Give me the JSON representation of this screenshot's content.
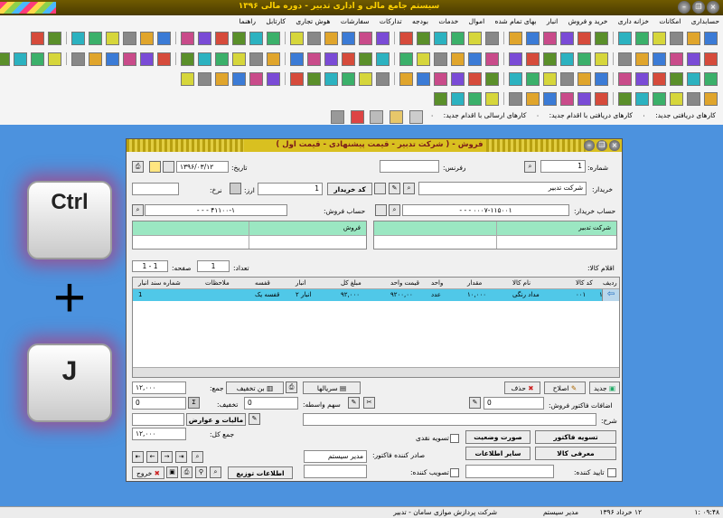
{
  "app": {
    "title": "سیستم جامع مالی و اداری تدبیر - دوره مالی ۱۳۹۶"
  },
  "menu": [
    "حسابداری",
    "امکانات",
    "خزانه داری",
    "خرید و فروش",
    "انبار",
    "بهای تمام شده",
    "اموال",
    "خدمات",
    "بودجه",
    "تدارکات",
    "سفارشات",
    "هوش تجاری",
    "کارتابل",
    "راهنما"
  ],
  "cartable": {
    "inbox": "کارهای دریافتی جدید:",
    "inbox_action": "کارهای دریافتی با اقدام جدید:",
    "sent_action": "کارهای ارسالی با اقدام جدید:"
  },
  "shortcut": {
    "key1": "Ctrl",
    "plus": "+",
    "key2": "J"
  },
  "status": {
    "time": "۰۹:۴۸ :۱",
    "date": "۱۲ خرداد ۱۳۹۶",
    "user": "مدیر سیستم",
    "company": "شرکت پردازش موازی سامان - تدبیر"
  },
  "window": {
    "title": "فروش - ( شرکت تدبیر - قیمت پیشنهادی - قیمت اول )",
    "number_label": "شماره:",
    "number_value": "1",
    "ref_label": "رفرنس:",
    "ref_value": "",
    "date_label": "تاریخ:",
    "date_value": "۱۳۹۶/۰۳/۱۲",
    "buyer_label": "خریدار:",
    "buyer_value": "شرکت تدبیر",
    "buyer_code_button": "کد خریدار",
    "currency_label": "ارز:",
    "currency_value": "1",
    "rate_label": "نرخ:",
    "rate_value": "",
    "buyer_account_label": "حساب خریدار:",
    "buyer_account_value": "- - - ۰۰۰۷-۱۱۵۰۰۱",
    "buyer_account_name": "شرکت تدبیر",
    "sales_account_label": "حساب فروش:",
    "sales_account_value": "- - - ۴۱۱۰۰-۱",
    "sales_account_name": "فروش",
    "items_label": "اقلام کالا:",
    "count_label": "تعداد:",
    "count_value": "1",
    "page_label": "صفحه:",
    "page_value": "1 - 1",
    "table": {
      "headers": [
        "ردیف",
        "کد کالا",
        "نام کالا",
        "مقدار",
        "واحد",
        "قیمت واحد",
        "مبلغ کل",
        "انبار",
        "قفسه",
        "ملاحظات",
        "شماره سند انبار"
      ],
      "rows": [
        [
          "۱",
          "۰۰۱",
          "مداد رنگی",
          "۱۰,۰۰۰",
          "عدد",
          "۹۲۰۰,۰۰",
          "۹۲,۰۰۰",
          "انبار ۲",
          "قفسه یک",
          "",
          "1"
        ]
      ]
    },
    "new_btn": "جدید",
    "edit_btn": "اصلاح",
    "delete_btn": "حذف",
    "series_btn": "سریالها",
    "discount_btn": "بن تخفیف",
    "sum_label": "جمع:",
    "sum_value": "۱۲,۰۰۰",
    "add_seller_label": "اضافات فاکتور فروش:",
    "add_seller_value": "0",
    "agent_share_label": "سهم واسطه:",
    "agent_share_value": "0",
    "discount_label": "تخفیف:",
    "discount_value": "0",
    "discount_value2": "0",
    "desc_label": "شرح:",
    "desc_value": "",
    "tax_btn": "مالیات و عوارض",
    "tax_value": "",
    "total_label": "جمع کل:",
    "total_value": "۱۲,۰۰۰",
    "settle_btn": "تسویه فاکتور",
    "invoice_status_btn": "صورت وضعیت",
    "cash_settle_label": "تسویه نقدی",
    "goods_intro_btn": "معرفی کالا",
    "other_info_btn": "سایر اطلاعات",
    "issuer_label": "صادر کننده فاکتور:",
    "issuer_value": "مدیر سیستم",
    "confirm_label": "تایید کننده:",
    "approve_label": "تصویب کننده:",
    "distribution_btn": "اطلاعات توزیع",
    "exit_btn": "خروج"
  }
}
